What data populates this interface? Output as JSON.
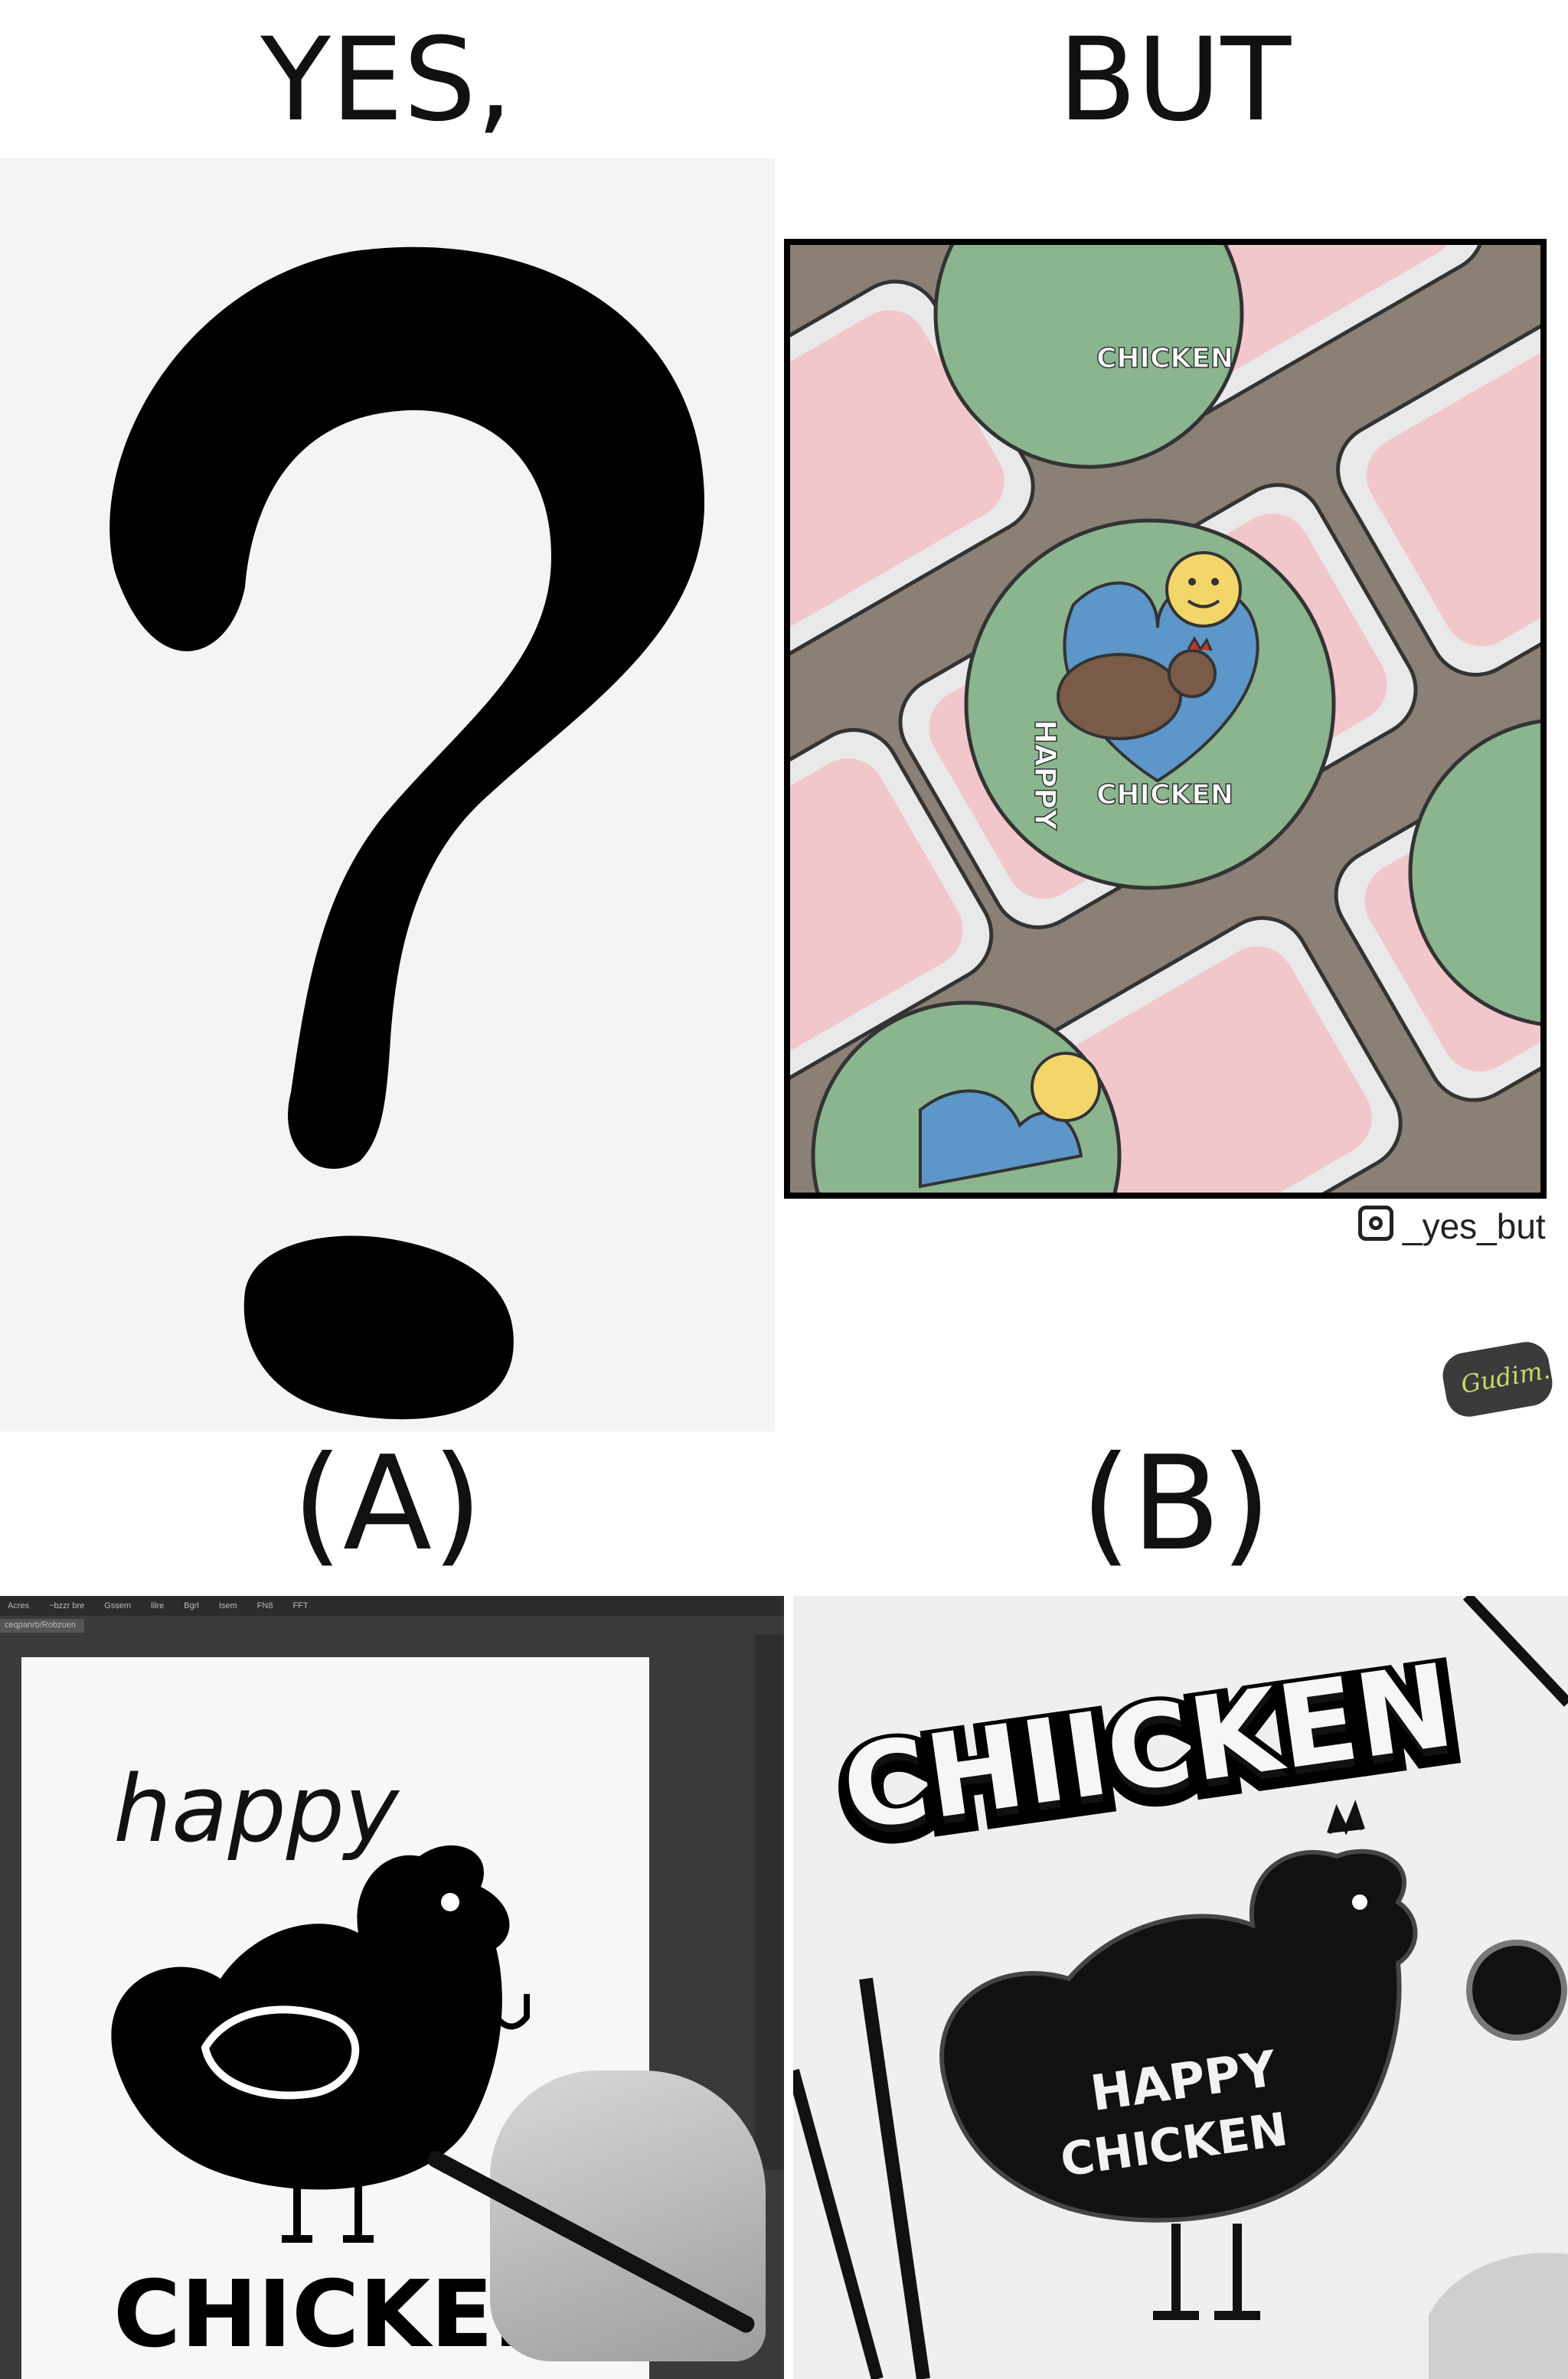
{
  "headings": {
    "left": "YES,",
    "right": "BUT"
  },
  "options": {
    "a": "(A)",
    "b": "(B)"
  },
  "credit": {
    "handle": "_yes_but",
    "signature": "Gudim."
  },
  "comic_panel": {
    "badge_word_top": "HAPPY",
    "badge_word_bottom": "CHICKEN"
  },
  "design_a": {
    "menu_items": [
      "Acres",
      "~bzzr bre",
      "Gssem",
      "lilre",
      "Bgrl",
      "Isem",
      "FN8",
      "FFT"
    ],
    "doc_tab": "ceqpanrb/Robzuen",
    "script_word": "happy",
    "block_word": "CHICKEN"
  },
  "design_b": {
    "headline": "CHIICKEN",
    "badge_line1": "HAPPY",
    "badge_line2": "CHICKEN"
  },
  "colors": {
    "comic_pink": "#f2c7cc",
    "comic_green": "#8ab58f",
    "comic_blue": "#5d96c9",
    "comic_yellow": "#f3d66a",
    "comic_tray": "#e9e9e9",
    "ink": "#000000"
  }
}
